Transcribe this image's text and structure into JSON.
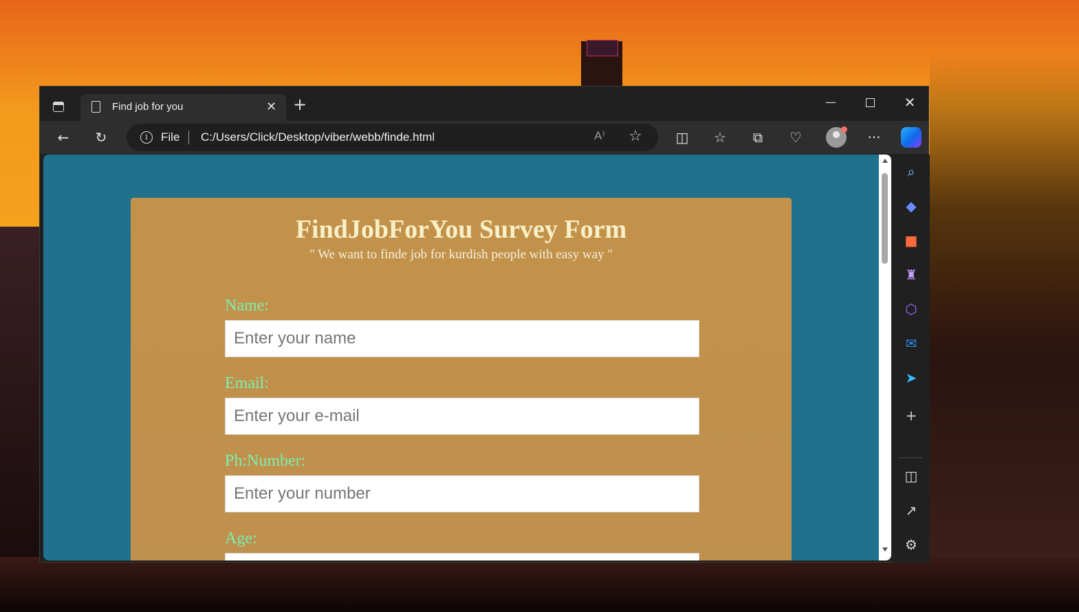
{
  "browser": {
    "tab": {
      "title": "Find job for you",
      "close_glyph": "✕"
    },
    "new_tab_glyph": "+",
    "window_controls": {
      "minimize": "—",
      "maximize": "",
      "close": "✕"
    },
    "address": {
      "scheme_label": "File",
      "url": "C:/Users/Click/Desktop/viber/webb/finde.html",
      "read_aloud": "A⁾"
    },
    "toolbar_icons": [
      "back-arrow-icon",
      "refresh-icon",
      "split-screen-icon",
      "favorites-icon",
      "collections-icon",
      "browser-essentials-icon",
      "profile-icon",
      "more-icon",
      "copilot-icon"
    ],
    "sidebar_icons": [
      "search-icon",
      "shopping-tag-icon",
      "tools-briefcase-icon",
      "games-icon",
      "microsoft-365-icon",
      "outlook-icon",
      "send-icon",
      "add-icon",
      "sidebar-toggle-icon",
      "open-external-icon",
      "settings-icon"
    ]
  },
  "page": {
    "background_color": "#20718d",
    "card_color": "#c3924a",
    "label_color": "#7af0b0",
    "title": "FindJobForYou Survey Form",
    "subtitle": "\" We want to finde job for kurdish people with easy way \"",
    "fields": [
      {
        "label": "Name:",
        "placeholder": "Enter your name"
      },
      {
        "label": "Email:",
        "placeholder": "Enter your e-mail"
      },
      {
        "label": "Ph:Number:",
        "placeholder": "Enter your number"
      },
      {
        "label": "Age:",
        "placeholder": ""
      }
    ]
  }
}
